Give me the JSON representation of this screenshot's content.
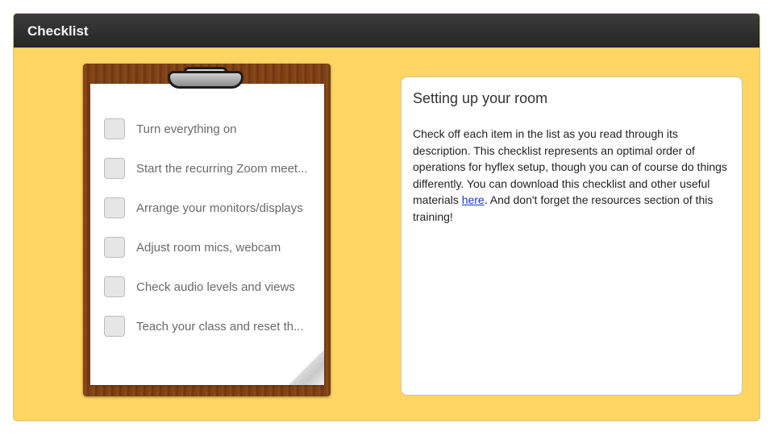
{
  "window": {
    "title": "Checklist"
  },
  "checklist": {
    "items": [
      {
        "label": "Turn everything on",
        "checked": false
      },
      {
        "label": "Start the recurring Zoom meet...",
        "checked": false
      },
      {
        "label": "Arrange your monitors/displays",
        "checked": false
      },
      {
        "label": "Adjust room mics, webcam",
        "checked": false
      },
      {
        "label": "Check audio levels and views",
        "checked": false
      },
      {
        "label": "Teach your class and reset th...",
        "checked": false
      }
    ]
  },
  "panel": {
    "title": "Setting up your room",
    "body_before_link": "Check off each item in the list as you read through its description. This checklist represents an optimal order of operations for hyflex setup, though you can of course do things differently. You can download this checklist and other useful materials ",
    "link_text": "here",
    "body_after_link": ". And don't forget the resources section of this training!"
  },
  "colors": {
    "background": "#fed661",
    "titlebar": "#2e2e2e",
    "link": "#1a36d6",
    "clipboard_wood": "#7a3e12"
  }
}
